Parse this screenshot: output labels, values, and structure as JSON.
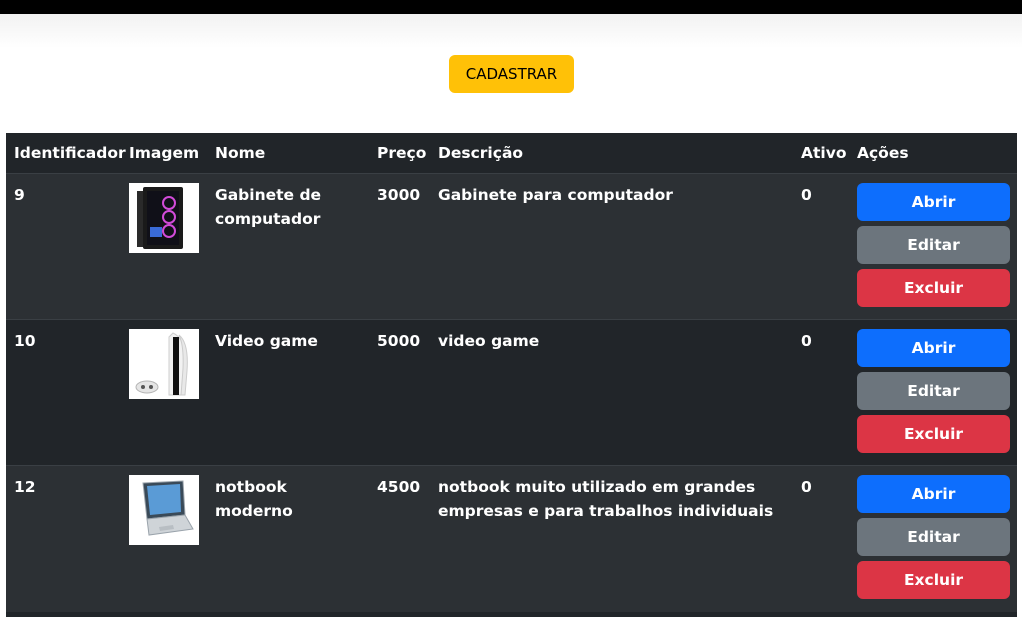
{
  "toolbar": {
    "register_label": "CADASTRAR"
  },
  "table": {
    "headers": {
      "id": "Identificador",
      "image": "Imagem",
      "name": "Nome",
      "price": "Preço",
      "description": "Descrição",
      "active": "Ativo",
      "actions": "Ações"
    },
    "action_labels": {
      "open": "Abrir",
      "edit": "Editar",
      "delete": "Excluir"
    },
    "rows": [
      {
        "id": "9",
        "image": "pc-case-image",
        "name": "Gabinete de computador",
        "price": "3000",
        "description": "Gabinete para computador",
        "active": "0"
      },
      {
        "id": "10",
        "image": "game-console-image",
        "name": "Video game",
        "price": "5000",
        "description": "video game",
        "active": "0"
      },
      {
        "id": "12",
        "image": "laptop-image",
        "name": "notbook moderno",
        "price": "4500",
        "description": "notbook muito utilizado em grandes empresas e para trabalhos individuais",
        "active": "0"
      }
    ]
  },
  "colors": {
    "register": "#ffc107",
    "open": "#0d6efd",
    "edit": "#6c757d",
    "delete": "#dc3545",
    "table_bg": "#212529"
  }
}
